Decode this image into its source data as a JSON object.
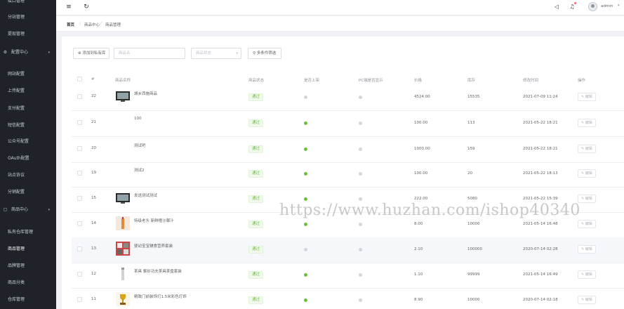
{
  "sidebar": {
    "items": [
      {
        "label": "接口管理",
        "type": "item"
      },
      {
        "label": "分站管理",
        "type": "item"
      },
      {
        "label": "提现管理",
        "type": "item"
      },
      {
        "label": "配置中心",
        "type": "group",
        "icon": "gear-icon"
      },
      {
        "label": "网站配置",
        "type": "item"
      },
      {
        "label": "上传配置",
        "type": "item"
      },
      {
        "label": "支付配置",
        "type": "item"
      },
      {
        "label": "短信配置",
        "type": "item"
      },
      {
        "label": "公众号配置",
        "type": "item"
      },
      {
        "label": "OAuth配置",
        "type": "item"
      },
      {
        "label": "站点协议",
        "type": "item"
      },
      {
        "label": "分销配置",
        "type": "item"
      },
      {
        "label": "商品中心",
        "type": "group",
        "icon": "bag-icon"
      },
      {
        "label": "私有仓库管理",
        "type": "item"
      },
      {
        "label": "商品管理",
        "type": "item"
      },
      {
        "label": "品牌管理",
        "type": "item"
      },
      {
        "label": "商品分类",
        "type": "item"
      },
      {
        "label": "仓库管理",
        "type": "item"
      }
    ]
  },
  "header": {
    "menu_icon": "menu-icon",
    "refresh_icon": "refresh-icon",
    "megaphone_icon": "megaphone-icon",
    "bell_icon": "bell-icon",
    "username": "admin"
  },
  "breadcrumb": [
    "首页",
    "商品中心",
    "商品管理"
  ],
  "toolbar": {
    "private_button": "添加到私有库",
    "name_placeholder": "商品名",
    "status_placeholder": "商品状态",
    "filter_button": "多条件筛选"
  },
  "table": {
    "columns": [
      "#",
      "商品名称",
      "商品状态",
      "是否上架",
      "PC端是否显示",
      "价格",
      "库存",
      "修改时间",
      "操作"
    ],
    "rows": [
      {
        "id": "22",
        "name": "城乡西施商品",
        "thumb": "tv",
        "status": "通过",
        "on_shelf": false,
        "pc_show": false,
        "price": "4524.00",
        "stock": "15535",
        "updated": "2021-07-09 11:24",
        "action": "编辑"
      },
      {
        "id": "21",
        "name": "100",
        "thumb": "none",
        "status": "通过",
        "on_shelf": true,
        "pc_show": false,
        "price": "100.00",
        "stock": "113",
        "updated": "2021-05-22 18:21",
        "action": "编辑"
      },
      {
        "id": "20",
        "name": "测试吧",
        "thumb": "none",
        "status": "通过",
        "on_shelf": true,
        "pc_show": false,
        "price": "1000.00",
        "stock": "159",
        "updated": "2021-05-22 18:21",
        "action": "编辑"
      },
      {
        "id": "19",
        "name": "测试2",
        "thumb": "none",
        "status": "通过",
        "on_shelf": true,
        "pc_show": false,
        "price": "100.00",
        "stock": "20",
        "updated": "2021-05-22 18:13",
        "action": "编辑"
      },
      {
        "id": "15",
        "name": "发送测试测试",
        "thumb": "tv",
        "status": "通过",
        "on_shelf": true,
        "pc_show": false,
        "price": "222.00",
        "stock": "5080",
        "updated": "2021-05-22 15:39",
        "action": "编辑"
      },
      {
        "id": "14",
        "name": "特级老头 新鲜橙沙棘汁",
        "thumb": "bottle",
        "status": "通过",
        "on_shelf": true,
        "pc_show": false,
        "price": "8.00",
        "stock": "10000",
        "updated": "2021-05-14 16:48",
        "action": "编辑"
      },
      {
        "id": "13",
        "name": "婴幼宝宝辅食营养套装",
        "thumb": "box",
        "status": "通过",
        "on_shelf": false,
        "pc_show": false,
        "price": "2.10",
        "stock": "100000",
        "updated": "2020-07-14 02:28",
        "action": "编辑"
      },
      {
        "id": "12",
        "name": "茶具 紫砂功夫茶具茶盘套装",
        "thumb": "tube",
        "status": "通过",
        "on_shelf": true,
        "pc_show": false,
        "price": "1.10",
        "stock": "99999",
        "updated": "2021-05-14 16:49",
        "action": "编辑"
      },
      {
        "id": "11",
        "name": "精致门前装饰灯1.5米彩色灯饰",
        "thumb": "trophy",
        "status": "通过",
        "on_shelf": true,
        "pc_show": false,
        "price": "8.90",
        "stock": "10000",
        "updated": "2020-07-14 02:18",
        "action": "编辑"
      }
    ]
  },
  "watermark": "https://www.huzhan.com/ishop40340",
  "colors": {
    "sidebar_bg": "#1f2329",
    "success": "#67c23a",
    "tag_bg": "#f0f9eb"
  }
}
